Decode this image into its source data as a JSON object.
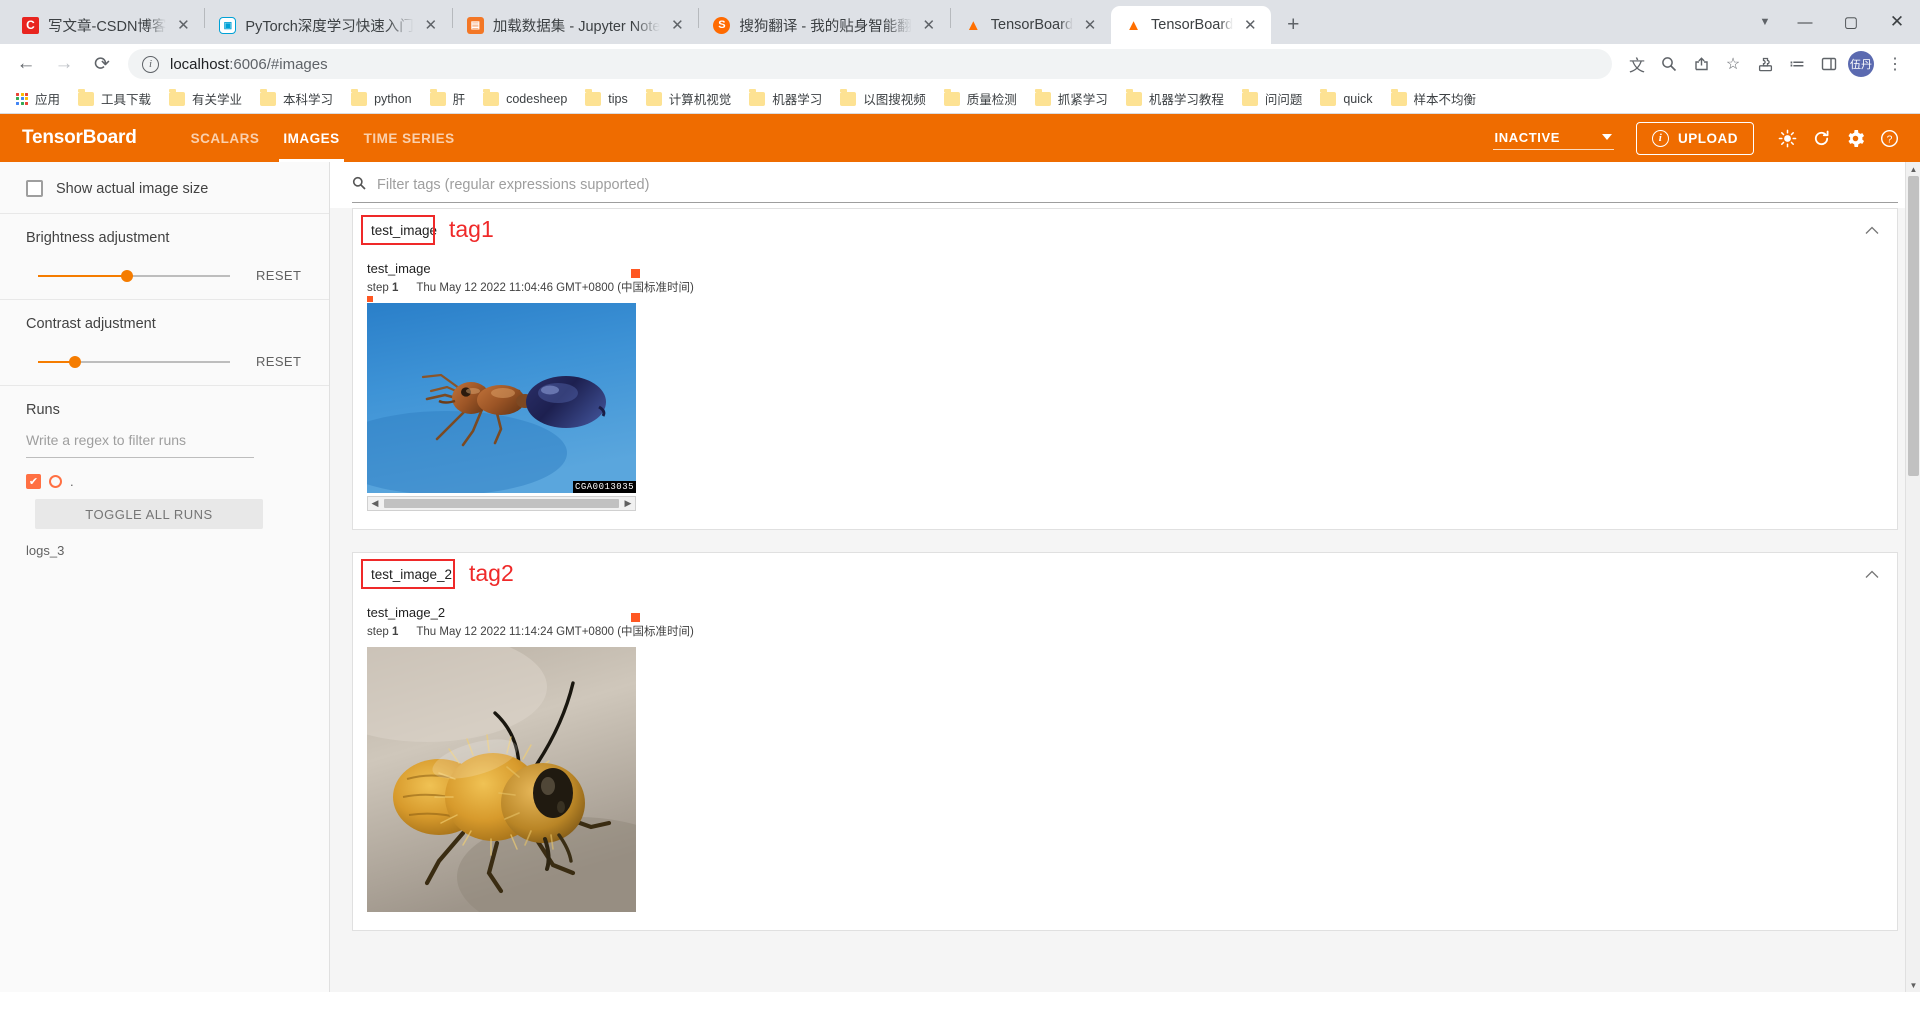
{
  "browser": {
    "tabs": [
      {
        "title": "写文章-CSDN博客",
        "favicon": "csdn-icon",
        "fav_glyph": "C",
        "active": false
      },
      {
        "title": "PyTorch深度学习快速入门",
        "favicon": "bilibili-icon",
        "fav_glyph": "bi",
        "active": false
      },
      {
        "title": "加载数据集 - Jupyter Note",
        "favicon": "jupyter-icon",
        "fav_glyph": "J",
        "active": false
      },
      {
        "title": "搜狗翻译 - 我的贴身智能翻",
        "favicon": "sogou-icon",
        "fav_glyph": "S",
        "active": false
      },
      {
        "title": "TensorBoard",
        "favicon": "tensorboard-icon",
        "fav_glyph": "▲",
        "active": false
      },
      {
        "title": "TensorBoard",
        "favicon": "tensorboard-icon",
        "fav_glyph": "▲",
        "active": true
      }
    ],
    "new_tab_label": "+",
    "tab_close_label": "✕",
    "tab_list_chevron": "▼",
    "window_minimize": "—",
    "window_maximize": "▢",
    "window_close": "✕",
    "nav": {
      "back": "←",
      "forward": "→",
      "reload": "⟳"
    },
    "omnibox": {
      "info_icon": "i",
      "url_host": "localhost",
      "url_rest": ":6006/#images"
    },
    "toolbar_icons": [
      {
        "name": "translate-icon",
        "glyph": "文"
      },
      {
        "name": "zoom-search-icon",
        "glyph": "🔍"
      },
      {
        "name": "share-icon",
        "glyph": "↗"
      },
      {
        "name": "bookmark-star-icon",
        "glyph": "☆"
      },
      {
        "name": "extensions-puzzle-icon",
        "glyph": "🧩"
      },
      {
        "name": "reading-list-icon",
        "glyph": "≔"
      },
      {
        "name": "side-panel-icon",
        "glyph": "▯"
      }
    ],
    "avatar_label": "伍丹",
    "browser_menu_icon": "⋮",
    "bookmarks": [
      {
        "label": "应用",
        "icon": "apps-grid-icon"
      },
      {
        "label": "工具下载",
        "icon": "folder-icon"
      },
      {
        "label": "有关学业",
        "icon": "folder-icon"
      },
      {
        "label": "本科学习",
        "icon": "folder-icon"
      },
      {
        "label": "python",
        "icon": "folder-icon"
      },
      {
        "label": "肝",
        "icon": "folder-icon"
      },
      {
        "label": "codesheep",
        "icon": "folder-icon"
      },
      {
        "label": "tips",
        "icon": "folder-icon"
      },
      {
        "label": "计算机视觉",
        "icon": "folder-icon"
      },
      {
        "label": "机器学习",
        "icon": "folder-icon"
      },
      {
        "label": "以图搜视频",
        "icon": "folder-icon"
      },
      {
        "label": "质量检测",
        "icon": "folder-icon"
      },
      {
        "label": "抓紧学习",
        "icon": "folder-icon"
      },
      {
        "label": "机器学习教程",
        "icon": "folder-icon"
      },
      {
        "label": "问问题",
        "icon": "folder-icon"
      },
      {
        "label": "quick",
        "icon": "folder-icon"
      },
      {
        "label": "样本不均衡",
        "icon": "folder-icon"
      }
    ]
  },
  "tensorboard": {
    "logo": "TensorBoard",
    "nav_tabs": [
      {
        "label": "SCALARS",
        "selected": false
      },
      {
        "label": "IMAGES",
        "selected": true
      },
      {
        "label": "TIME SERIES",
        "selected": false
      }
    ],
    "reload_status": "INACTIVE",
    "reload_caret": "▾",
    "upload_label": "UPLOAD",
    "upload_info_icon": "i",
    "header_icons": [
      {
        "name": "brightness-theme-icon",
        "glyph": "☀"
      },
      {
        "name": "refresh-icon",
        "glyph": "⟳"
      },
      {
        "name": "settings-gear-icon",
        "glyph": "⚙"
      },
      {
        "name": "help-question-icon",
        "glyph": "?"
      }
    ],
    "sidebar": {
      "show_actual_image_size": "Show actual image size",
      "show_actual_checked": false,
      "brightness": {
        "title": "Brightness adjustment",
        "reset_label": "RESET",
        "value_pct": 49
      },
      "contrast": {
        "title": "Contrast adjustment",
        "reset_label": "RESET",
        "value_pct": 18
      },
      "runs_title": "Runs",
      "runs_filter_placeholder": "Write a regex to filter runs",
      "run_items": [
        {
          "name": ".",
          "checked": true,
          "color": "#ff7043"
        }
      ],
      "toggle_all_label": "TOGGLE ALL RUNS",
      "log_dir": "logs_3"
    },
    "filter": {
      "search_icon": "search-icon",
      "placeholder": "Filter tags (regular expressions supported)",
      "value": ""
    },
    "cards": [
      {
        "tag": "test_image",
        "annotation": "tag1",
        "collapse_icon": "▲",
        "image_title": "test_image",
        "step_label": "step",
        "step_value": "1",
        "timestamp": "Thu May 12 2022 11:04:46 GMT+0800 (中国标准时间)",
        "photo": "ant-macro-photo",
        "photo_badge": "CGA0013035",
        "scroll_left": "◀",
        "scroll_right": "▶"
      },
      {
        "tag": "test_image_2",
        "annotation": "tag2",
        "collapse_icon": "▲",
        "image_title": "test_image_2",
        "step_label": "step",
        "step_value": "1",
        "timestamp": "Thu May 12 2022 11:14:24 GMT+0800 (中国标准时间)",
        "photo": "bee-macro-photo",
        "photo_badge": "",
        "scroll_left": "◀",
        "scroll_right": "▶"
      }
    ]
  },
  "colors": {
    "tb_orange": "#ef6c00",
    "accent_orange": "#f57c00",
    "run_orange": "#ff7043",
    "annotation_red": "#ef2929"
  }
}
